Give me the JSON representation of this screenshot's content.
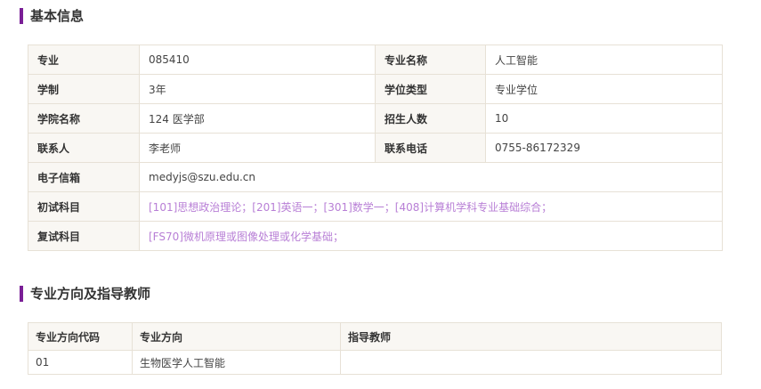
{
  "basic": {
    "title": "基本信息",
    "major_label": "专业",
    "major_value": "085410",
    "major_name_label": "专业名称",
    "major_name_value": "人工智能",
    "duration_label": "学制",
    "duration_value": "3年",
    "degree_type_label": "学位类型",
    "degree_type_value": "专业学位",
    "college_label": "学院名称",
    "college_value": "124 医学部",
    "enrollment_label": "招生人数",
    "enrollment_value": "10",
    "contact_label": "联系人",
    "contact_value": "李老师",
    "phone_label": "联系电话",
    "phone_value": "0755-86172329",
    "email_label": "电子信箱",
    "email_value": "medyjs@szu.edu.cn",
    "prelim_label": "初试科目",
    "prelim_value": "[101]思想政治理论；[201]英语一；[301]数学一；[408]计算机学科专业基础综合；",
    "retest_label": "复试科目",
    "retest_value": "[FS70]微机原理或图像处理或化学基础；"
  },
  "directions": {
    "title": "专业方向及指导教师",
    "headers": [
      "专业方向代码",
      "专业方向",
      "指导教师"
    ],
    "rows": [
      {
        "code": "01",
        "direction": "生物医学人工智能",
        "advisor": ""
      }
    ]
  },
  "colors": {
    "accent": "#7a1f96",
    "link": "#b87fd6",
    "label_bg": "#f9f7f3",
    "border": "#e7e1d6"
  }
}
